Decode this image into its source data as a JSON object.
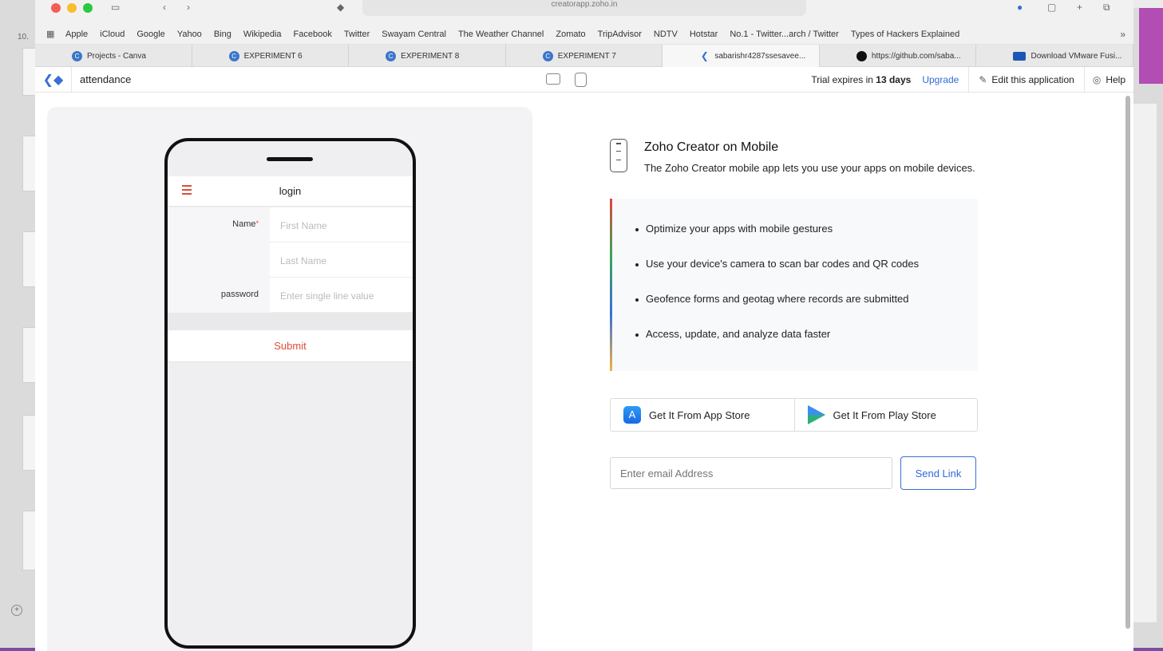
{
  "desktop": {
    "side_number": "10."
  },
  "browser": {
    "url": "creatorapp.zoho.in",
    "bookmarks": [
      "Apple",
      "iCloud",
      "Google",
      "Yahoo",
      "Bing",
      "Wikipedia",
      "Facebook",
      "Twitter",
      "Swayam Central",
      "The Weather Channel",
      "Zomato",
      "TripAdvisor",
      "NDTV",
      "Hotstar",
      "No.1 - Twitter...arch / Twitter",
      "Types of Hackers Explained"
    ],
    "more_glyph": "»",
    "tabs": [
      {
        "label": "Projects - Canva",
        "icon": "canva-icon"
      },
      {
        "label": "EXPERIMENT 6",
        "icon": "canva-icon"
      },
      {
        "label": "EXPERIMENT 8",
        "icon": "canva-icon"
      },
      {
        "label": "EXPERIMENT 7",
        "icon": "canva-icon"
      },
      {
        "label": "sabarishr4287ssesavee...",
        "icon": "zoho-creator-icon",
        "active": true
      },
      {
        "label": "https://github.com/saba...",
        "icon": "github-icon"
      },
      {
        "label": "Download VMware Fusi...",
        "icon": "vmware-icon"
      }
    ]
  },
  "app_header": {
    "app_name": "attendance",
    "trial_prefix": "Trial expires in ",
    "trial_days": "13 days",
    "upgrade": "Upgrade",
    "edit": "Edit this application",
    "help": "Help"
  },
  "phone": {
    "title": "login",
    "name_label": "Name",
    "required_mark": "*",
    "first_name_placeholder": "First Name",
    "last_name_placeholder": "Last Name",
    "password_label": "password",
    "password_placeholder": "Enter single line value",
    "submit": "Submit"
  },
  "info": {
    "title": "Zoho Creator on Mobile",
    "subtitle": "The Zoho Creator mobile app lets you use your apps on mobile devices.",
    "features": [
      "Optimize your apps with mobile gestures",
      "Use your device's camera to scan bar codes and QR codes",
      "Geofence forms and geotag where records are submitted",
      "Access, update, and analyze data faster"
    ],
    "app_store": "Get It From App Store",
    "play_store": "Get It From Play Store",
    "email_placeholder": "Enter email Address",
    "send_link": "Send Link"
  },
  "colors": {
    "accent": "#2f6bd8",
    "danger": "#e24a3a"
  }
}
